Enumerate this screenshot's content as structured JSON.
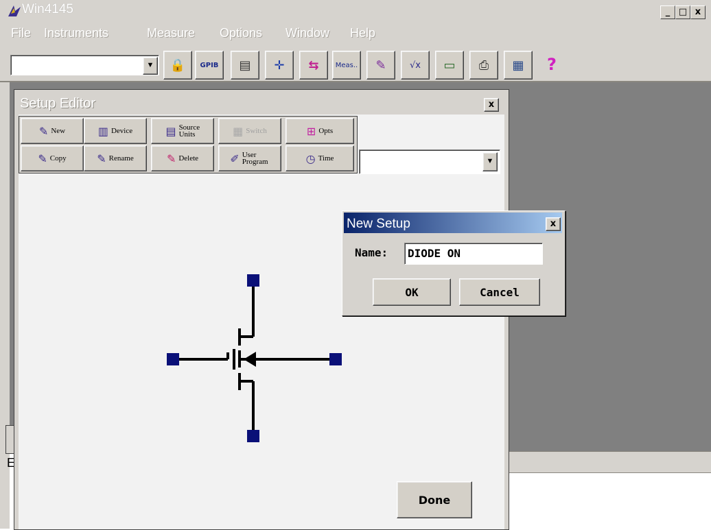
{
  "app": {
    "title": "Win4145",
    "window_controls": {
      "minimize": "_",
      "maximize": "□",
      "close": "x"
    }
  },
  "menu": [
    "File",
    "Instruments",
    "Measure",
    "Options",
    "Window",
    "Help"
  ],
  "toolbar": {
    "combo_value": "",
    "tools": [
      {
        "icon": "lock-icon",
        "glyph": "🔒"
      },
      {
        "icon": "gpib-icon",
        "glyph": "GPIB"
      },
      {
        "icon": "instrument-panel-icon",
        "glyph": "▤"
      },
      {
        "icon": "crosshair-icon",
        "glyph": "✛"
      },
      {
        "icon": "swap-icon",
        "glyph": "⇆"
      },
      {
        "icon": "measure-icon",
        "glyph": "Meas.."
      },
      {
        "icon": "graph-edit-icon",
        "glyph": "✎"
      },
      {
        "icon": "formula-icon",
        "glyph": "√x"
      },
      {
        "icon": "computer-icon",
        "glyph": "▭"
      },
      {
        "icon": "printer-icon",
        "glyph": "⎙"
      },
      {
        "icon": "clipboard-icon",
        "glyph": "▦"
      },
      {
        "icon": "help-icon",
        "glyph": "?"
      }
    ]
  },
  "setup_editor": {
    "title": "Setup Editor",
    "close": "x",
    "buttons_row1": [
      {
        "label": "New",
        "icon": "new-icon",
        "glyph": "✎",
        "enabled": true
      },
      {
        "label": "Device",
        "icon": "device-icon",
        "glyph": "▥",
        "enabled": true
      },
      {
        "label": "Source Units",
        "icon": "source-units-icon",
        "glyph": "▤",
        "enabled": true
      },
      {
        "label": "Switch",
        "icon": "switch-icon",
        "glyph": "▦",
        "enabled": false
      },
      {
        "label": "Opts",
        "icon": "options-icon",
        "glyph": "⊞",
        "enabled": true
      }
    ],
    "buttons_row2": [
      {
        "label": "Copy",
        "icon": "copy-icon",
        "glyph": "✎",
        "enabled": true
      },
      {
        "label": "Rename",
        "icon": "rename-icon",
        "glyph": "✎",
        "enabled": true
      },
      {
        "label": "Delete",
        "icon": "delete-icon",
        "glyph": "✎",
        "enabled": true
      },
      {
        "label": "User Program",
        "icon": "user-program-icon",
        "glyph": "✐",
        "enabled": true
      },
      {
        "label": "Time",
        "icon": "clock-icon",
        "glyph": "◷",
        "enabled": true
      }
    ],
    "setup_select_value": "",
    "done_label": "Done",
    "terminal_color": "#0a1078"
  },
  "dialog": {
    "title": "New Setup",
    "close": "x",
    "name_label": "Name:",
    "name_value": "DIODE ON",
    "ok_label": "OK",
    "cancel_label": "Cancel"
  },
  "left_edge_text": "E"
}
